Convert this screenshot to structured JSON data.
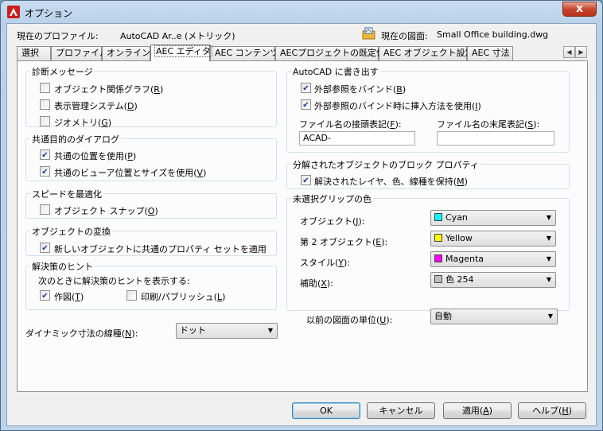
{
  "window": {
    "title": "オプション",
    "close": "x"
  },
  "profile": {
    "label": "現在のプロファイル:",
    "value": "AutoCAD Ar..e (メトリック)",
    "drawing_label": "現在の図面:",
    "drawing_value": "Small Office building.dwg"
  },
  "tabs": [
    "選択",
    "プロファイル",
    "オンライン",
    "AEC エディタ",
    "AEC コンテンツ",
    "AECプロジェクトの既定値",
    "AEC オブジェクト設定",
    "AEC 寸法"
  ],
  "diag": {
    "title": "診断メッセージ",
    "items": [
      {
        "pre": "オブジェクト関係グラフ(",
        "key": "R",
        "post": ")",
        "checked": false
      },
      {
        "pre": "表示管理システム(",
        "key": "D",
        "post": ")",
        "checked": false
      },
      {
        "pre": "ジオメトリ(",
        "key": "G",
        "post": ")",
        "checked": false
      }
    ]
  },
  "common": {
    "title": "共通目的のダイアログ",
    "items": [
      {
        "pre": "共通の位置を使用(",
        "key": "P",
        "post": ")",
        "checked": true
      },
      {
        "pre": "共通のビューア位置とサイズを使用(",
        "key": "V",
        "post": ")",
        "checked": true
      }
    ]
  },
  "speed": {
    "title": "スピードを最適化",
    "item": {
      "pre": "オブジェクト スナップ(",
      "key": "O",
      "post": ")",
      "checked": false
    }
  },
  "convert": {
    "title": "オブジェクトの変換",
    "item": {
      "pre": "新しいオブジェクトに共通のプロパティ セットを適用",
      "checked": true
    }
  },
  "hints": {
    "title": "解決策のヒント",
    "desc": "次のときに解決策のヒントを表示する:",
    "draw": {
      "pre": "作図(",
      "key": "T",
      "post": ")",
      "checked": true
    },
    "print": {
      "pre": "印刷/パブリッシュ(",
      "key": "L",
      "post": ")",
      "checked": false
    }
  },
  "dimline": {
    "pre": "ダイナミック寸法の線種(",
    "key": "N",
    "post": "):",
    "value": "ドット"
  },
  "export": {
    "title": "AutoCAD に書き出す",
    "bind": {
      "pre": "外部参照をバインド(",
      "key": "B",
      "post": ")",
      "checked": true
    },
    "insert": {
      "pre": "外部参照のバインド時に挿入方法を使用(",
      "key": "I",
      "post": ")",
      "checked": true
    },
    "prefix_label": {
      "pre": "ファイル名の接頭表記(",
      "key": "F",
      "post": "):"
    },
    "prefix_value": "ACAD-",
    "suffix_label": {
      "pre": "ファイル名の末尾表記(",
      "key": "S",
      "post": "):"
    },
    "suffix_value": ""
  },
  "explode": {
    "title": "分解されたオブジェクトのブロック プロパティ",
    "item": {
      "pre": "解決されたレイヤ、色、線種を保持(",
      "key": "M",
      "post": ")",
      "checked": true
    }
  },
  "grips": {
    "title": "未選択グリップの色",
    "rows": [
      {
        "pre": "オブジェクト(",
        "key": "J",
        "post": "):",
        "value": "Cyan",
        "color": "#00ffff"
      },
      {
        "pre": "第 2 オブジェクト(",
        "key": "E",
        "post": "):",
        "value": "Yellow",
        "color": "#ffff00"
      },
      {
        "pre": "スタイル(",
        "key": "Y",
        "post": "):",
        "value": "Magenta",
        "color": "#ff00ff"
      },
      {
        "pre": "補助(",
        "key": "X",
        "post": "):",
        "value": "色 254",
        "color": "#c0c0c0"
      }
    ]
  },
  "units": {
    "pre": "以前の図面の単位(",
    "key": "U",
    "post": "):",
    "value": "自動"
  },
  "buttons": {
    "ok": {
      "pre": "OK",
      "key": "",
      "post": ""
    },
    "cancel": {
      "pre": "キャンセル",
      "key": "",
      "post": ""
    },
    "apply": {
      "pre": "適用(",
      "key": "A",
      "post": ")"
    },
    "help": {
      "pre": "ヘルプ(",
      "key": "H",
      "post": ")"
    }
  },
  "colors": {
    "accent": "#3c7fb1",
    "title_bar": "#b9d1ea",
    "close": "#c7452b"
  },
  "icons": {
    "app": "autocad-logo-icon",
    "drawing": "drawing-folder-icon",
    "checkmark": "checkmark-icon",
    "arrow": "chevron-down-icon"
  }
}
